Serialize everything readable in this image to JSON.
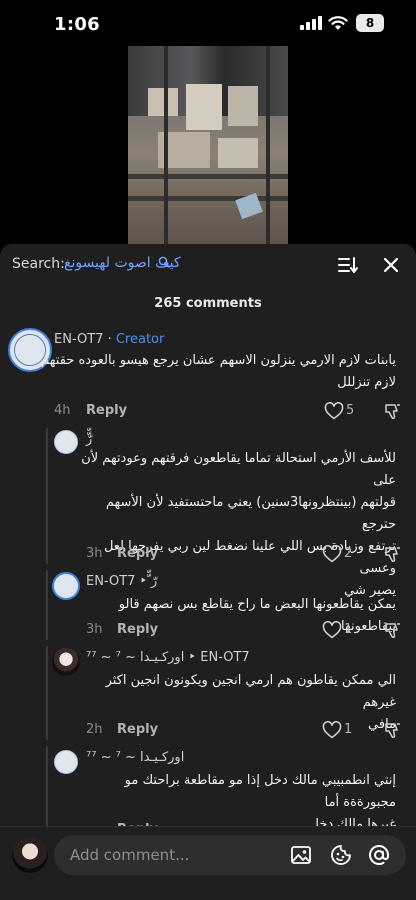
{
  "status_bar": {
    "time": "1:06",
    "battery": "8"
  },
  "search": {
    "label": "Search:",
    "query": "كيف اصوت لهيسونغ"
  },
  "comment_count": "265 comments",
  "comments": [
    {
      "username": "EN-OT7",
      "separator": " · ",
      "badge": "Creator",
      "text_line1": "يابنات لازم الارمي ينزلون الاسهم عشان يرجع هيسو بالعوده حقتهم",
      "text_line2": "لازم تنزللل",
      "time": "4h",
      "reply": "Reply",
      "likes": "5"
    },
    {
      "username": "ّّرّ",
      "text_line1": "للأسف الأرمي استحالة تماما يقاطعون فرقتهم وعودتهم لأن على",
      "text_line2": "قولتهم (بينتظرونها3سنين) يعني ماحتستفيد لأن الأسهم حترجع",
      "text_line3": "ترتفع وزيادة بس اللي علينا نضغط لين ربي يفرجها لعل وعسى",
      "text_line4": "يصير شي",
      "time": "3h",
      "reply": "Reply",
      "likes": "2"
    },
    {
      "username": "EN-OT7 ‣ ّّرّ",
      "text_line1": "يمكن يقاطعونها البعض ما راح يقاطع بس نصهم قالو بيقاطعونها",
      "time": "3h",
      "reply": "Reply",
      "likes": "1"
    },
    {
      "username": "⁷اوركـيـدا ~ ⁷ ~ ⁷ ‣ EN-OT7",
      "text_line1": "الي ممكن يقاطون هم ارمي انجين ويكونون انجين اكثر غيرهم",
      "text_line2": "مافي",
      "time": "2h",
      "reply": "Reply",
      "likes": "1"
    },
    {
      "username": "⁷اوركـيـدا ~ ⁷ ~ ⁷",
      "text_line1": "إنتي انطمبيبي مالك دخل إذا مو مقاطعة براحتك مو مجبورةةة أما",
      "text_line2": "غيرها مالك دخل",
      "reply": "Reply"
    }
  ],
  "bottom_bar": {
    "placeholder": "Add comment..."
  },
  "colors": {
    "sheet_bg": "#1f1f1f",
    "creator": "#4d8ff0",
    "search_query": "#6fa3ff"
  }
}
